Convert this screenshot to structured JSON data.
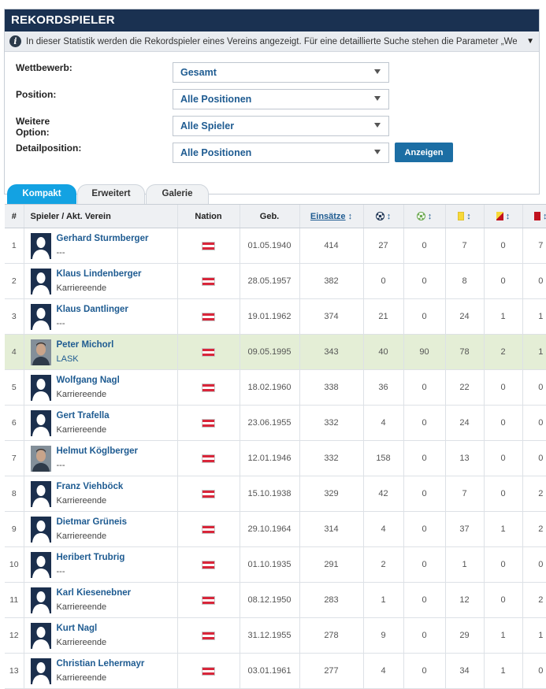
{
  "header": {
    "title": "REKORDSPIELER"
  },
  "info": {
    "text": "In dieser Statistik werden die Rekordspieler eines Vereins angezeigt. Für eine detaillierte Suche stehen die Parameter „Wettbewerb“, „Positio..."
  },
  "filters": {
    "wettbewerb": {
      "label": "Wettbewerb:",
      "value": "Gesamt"
    },
    "position": {
      "label": "Position:",
      "value": "Alle Positionen"
    },
    "option": {
      "label": "Weitere Option:",
      "value": "Alle Spieler"
    },
    "detail": {
      "label": "Detailposition:",
      "value": "Alle Positionen"
    },
    "button": "Anzeigen"
  },
  "tabs": [
    "Kompakt",
    "Erweitert",
    "Galerie"
  ],
  "table": {
    "headers": {
      "num": "#",
      "player": "Spieler / Akt. Verein",
      "nation": "Nation",
      "born": "Geb.",
      "apps": "Einsätze"
    },
    "rows": [
      {
        "n": "1",
        "name": "Gerhard Sturmberger",
        "club": "---",
        "club_link": false,
        "photo": false,
        "born": "01.05.1940",
        "apps": "414",
        "goals": "27",
        "assists": "0",
        "yellow": "7",
        "yellowred": "0",
        "red": "7"
      },
      {
        "n": "2",
        "name": "Klaus Lindenberger",
        "club": "Karriereende",
        "club_link": false,
        "photo": false,
        "born": "28.05.1957",
        "apps": "382",
        "goals": "0",
        "assists": "0",
        "yellow": "8",
        "yellowred": "0",
        "red": "0"
      },
      {
        "n": "3",
        "name": "Klaus Dantlinger",
        "club": "---",
        "club_link": false,
        "photo": false,
        "born": "19.01.1962",
        "apps": "374",
        "goals": "21",
        "assists": "0",
        "yellow": "24",
        "yellowred": "1",
        "red": "1"
      },
      {
        "n": "4",
        "name": "Peter Michorl",
        "club": "LASK",
        "club_link": true,
        "photo": true,
        "highlight": true,
        "born": "09.05.1995",
        "apps": "343",
        "goals": "40",
        "assists": "90",
        "yellow": "78",
        "yellowred": "2",
        "red": "1"
      },
      {
        "n": "5",
        "name": "Wolfgang Nagl",
        "club": "Karriereende",
        "club_link": false,
        "photo": false,
        "born": "18.02.1960",
        "apps": "338",
        "goals": "36",
        "assists": "0",
        "yellow": "22",
        "yellowred": "0",
        "red": "0"
      },
      {
        "n": "6",
        "name": "Gert Trafella",
        "club": "Karriereende",
        "club_link": false,
        "photo": false,
        "born": "23.06.1955",
        "apps": "332",
        "goals": "4",
        "assists": "0",
        "yellow": "24",
        "yellowred": "0",
        "red": "0"
      },
      {
        "n": "7",
        "name": "Helmut Köglberger",
        "club": "---",
        "club_link": false,
        "photo": true,
        "born": "12.01.1946",
        "apps": "332",
        "goals": "158",
        "assists": "0",
        "yellow": "13",
        "yellowred": "0",
        "red": "0"
      },
      {
        "n": "8",
        "name": "Franz Viehböck",
        "club": "Karriereende",
        "club_link": false,
        "photo": false,
        "born": "15.10.1938",
        "apps": "329",
        "goals": "42",
        "assists": "0",
        "yellow": "7",
        "yellowred": "0",
        "red": "2"
      },
      {
        "n": "9",
        "name": "Dietmar Grüneis",
        "club": "Karriereende",
        "club_link": false,
        "photo": false,
        "born": "29.10.1964",
        "apps": "314",
        "goals": "4",
        "assists": "0",
        "yellow": "37",
        "yellowred": "1",
        "red": "2"
      },
      {
        "n": "10",
        "name": "Heribert Trubrig",
        "club": "---",
        "club_link": false,
        "photo": false,
        "born": "01.10.1935",
        "apps": "291",
        "goals": "2",
        "assists": "0",
        "yellow": "1",
        "yellowred": "0",
        "red": "0"
      },
      {
        "n": "11",
        "name": "Karl Kiesenebner",
        "club": "Karriereende",
        "club_link": false,
        "photo": false,
        "born": "08.12.1950",
        "apps": "283",
        "goals": "1",
        "assists": "0",
        "yellow": "12",
        "yellowred": "0",
        "red": "2"
      },
      {
        "n": "12",
        "name": "Kurt Nagl",
        "club": "Karriereende",
        "club_link": false,
        "photo": false,
        "born": "31.12.1955",
        "apps": "278",
        "goals": "9",
        "assists": "0",
        "yellow": "29",
        "yellowred": "1",
        "red": "1"
      },
      {
        "n": "13",
        "name": "Christian Lehermayr",
        "club": "Karriereende",
        "club_link": false,
        "photo": false,
        "born": "03.01.1961",
        "apps": "277",
        "goals": "4",
        "assists": "0",
        "yellow": "34",
        "yellowred": "1",
        "red": "0"
      }
    ]
  },
  "colors": {
    "header_bg": "#1a3151",
    "link": "#1e5b91",
    "tab_active": "#13a2e2",
    "highlight_row": "#e4eed6",
    "button": "#1c6ea4"
  },
  "icons": {
    "info": "info-icon",
    "goal": "goal-ball-icon",
    "assist": "assist-ball-icon",
    "yellow": "yellow-card-icon",
    "yellowred": "yellow-red-card-icon",
    "red": "red-card-icon",
    "flag": "austria-flag-icon"
  }
}
